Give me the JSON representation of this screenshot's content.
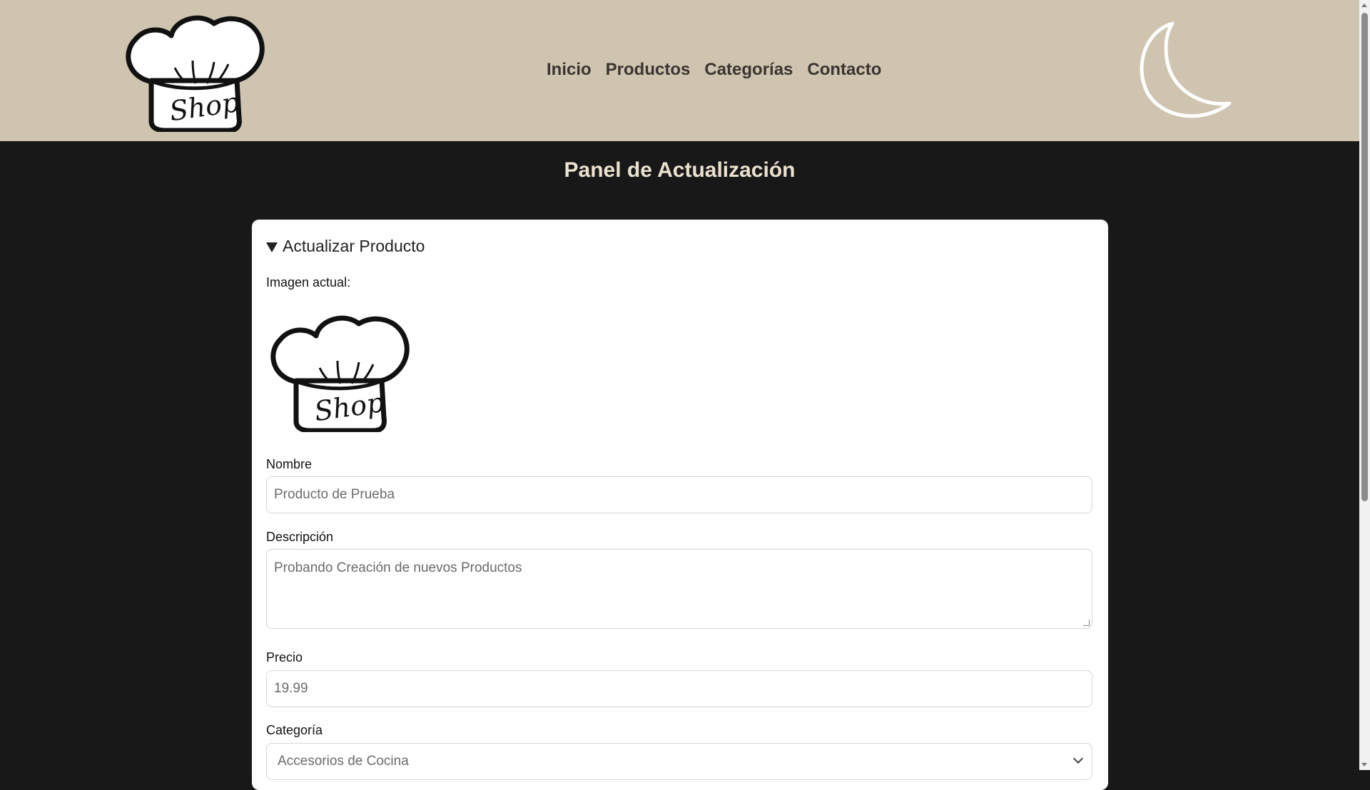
{
  "header": {
    "logo_text": "Shop",
    "nav": [
      "Inicio",
      "Productos",
      "Categorías",
      "Contacto"
    ],
    "theme_toggle_icon": "moon-icon"
  },
  "page": {
    "title": "Panel de Actualización"
  },
  "panel": {
    "summary": "Actualizar Producto",
    "image_label": "Imagen actual:",
    "image_text": "Shop",
    "fields": {
      "nombre": {
        "label": "Nombre",
        "value": "Producto de Prueba"
      },
      "descripcion": {
        "label": "Descripción",
        "value": "Probando Creación de nuevos Productos"
      },
      "precio": {
        "label": "Precio",
        "value": "19.99"
      },
      "categoria": {
        "label": "Categoría",
        "value": "Accesorios de Cocina"
      }
    }
  },
  "colors": {
    "header_bg": "#cfc4b0",
    "page_bg": "#181818",
    "title": "#eae1d0"
  }
}
